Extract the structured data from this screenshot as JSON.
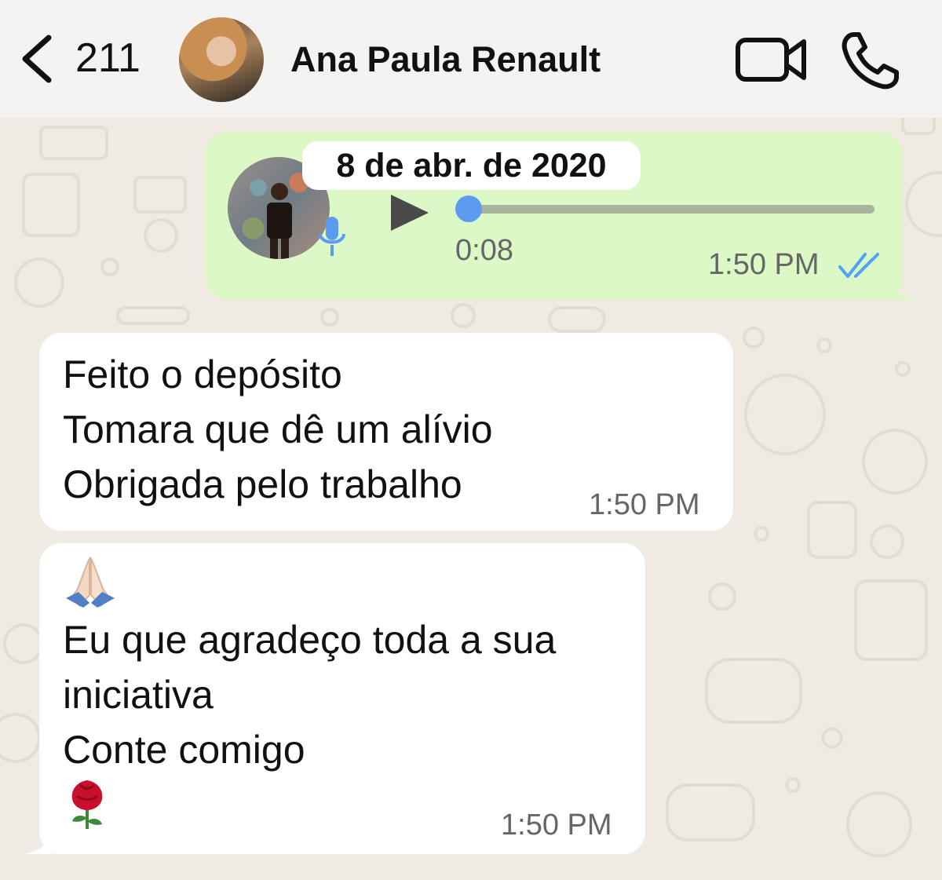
{
  "header": {
    "back_count": "211",
    "contact_name": "Ana Paula Renault"
  },
  "date_separator": "8 de abr. de 2020",
  "voice_message": {
    "progress": 0.0,
    "duration": "0:08",
    "time": "1:50 PM",
    "status": "read"
  },
  "messages": [
    {
      "lines": [
        "Feito o depósito",
        "Tomara que dê um alívio",
        "Obrigada pelo trabalho"
      ],
      "time": "1:50 PM"
    },
    {
      "lines": [
        "Eu que agradeço toda a sua",
        "iniciativa",
        "Conte comigo"
      ],
      "time": "1:50 PM",
      "emoji_top": "folded-hands",
      "emoji_bottom": "rose"
    }
  ],
  "colors": {
    "outgoing_bubble": "#dcf8c6",
    "incoming_bubble": "#ffffff",
    "background": "#efeae2",
    "read_ticks": "#4fa3f7",
    "progress_knob": "#5d9bf1"
  }
}
